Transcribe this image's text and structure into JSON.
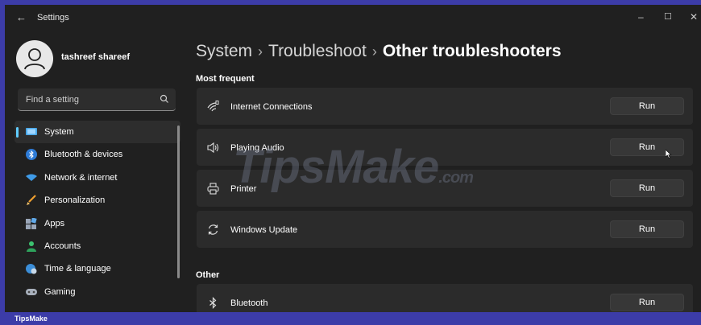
{
  "window": {
    "back_glyph": "←",
    "title": "Settings",
    "minimize_glyph": "–",
    "maximize_glyph": "☐",
    "close_glyph": "✕"
  },
  "profile": {
    "name": "tashreef shareef"
  },
  "search": {
    "placeholder": "Find a setting"
  },
  "sidebar": {
    "items": [
      {
        "label": "System",
        "icon": "monitor-icon",
        "active": true
      },
      {
        "label": "Bluetooth & devices",
        "icon": "bluetooth-icon"
      },
      {
        "label": "Network & internet",
        "icon": "wifi-icon"
      },
      {
        "label": "Personalization",
        "icon": "brush-icon"
      },
      {
        "label": "Apps",
        "icon": "apps-icon"
      },
      {
        "label": "Accounts",
        "icon": "person-icon"
      },
      {
        "label": "Time & language",
        "icon": "globe-clock-icon"
      },
      {
        "label": "Gaming",
        "icon": "gamepad-icon"
      }
    ]
  },
  "breadcrumb": {
    "part1": "System",
    "part2": "Troubleshoot",
    "current": "Other troubleshooters",
    "separator": "›"
  },
  "sections": {
    "most_frequent": "Most frequent",
    "other": "Other"
  },
  "troubleshooters": [
    {
      "label": "Internet Connections",
      "icon": "network-icon",
      "button": "Run"
    },
    {
      "label": "Playing Audio",
      "icon": "speaker-icon",
      "button": "Run"
    },
    {
      "label": "Printer",
      "icon": "printer-icon",
      "button": "Run"
    },
    {
      "label": "Windows Update",
      "icon": "sync-icon",
      "button": "Run"
    },
    {
      "label": "Bluetooth",
      "icon": "bluetooth-icon",
      "button": "Run"
    }
  ],
  "watermark": {
    "main": "TipsMake",
    "suffix": ".com"
  },
  "footer": {
    "label": "TipsMake"
  },
  "colors": {
    "accent": "#60cdff",
    "background": "#202020",
    "card": "#2b2b2b",
    "frame": "#3c3ca8"
  }
}
